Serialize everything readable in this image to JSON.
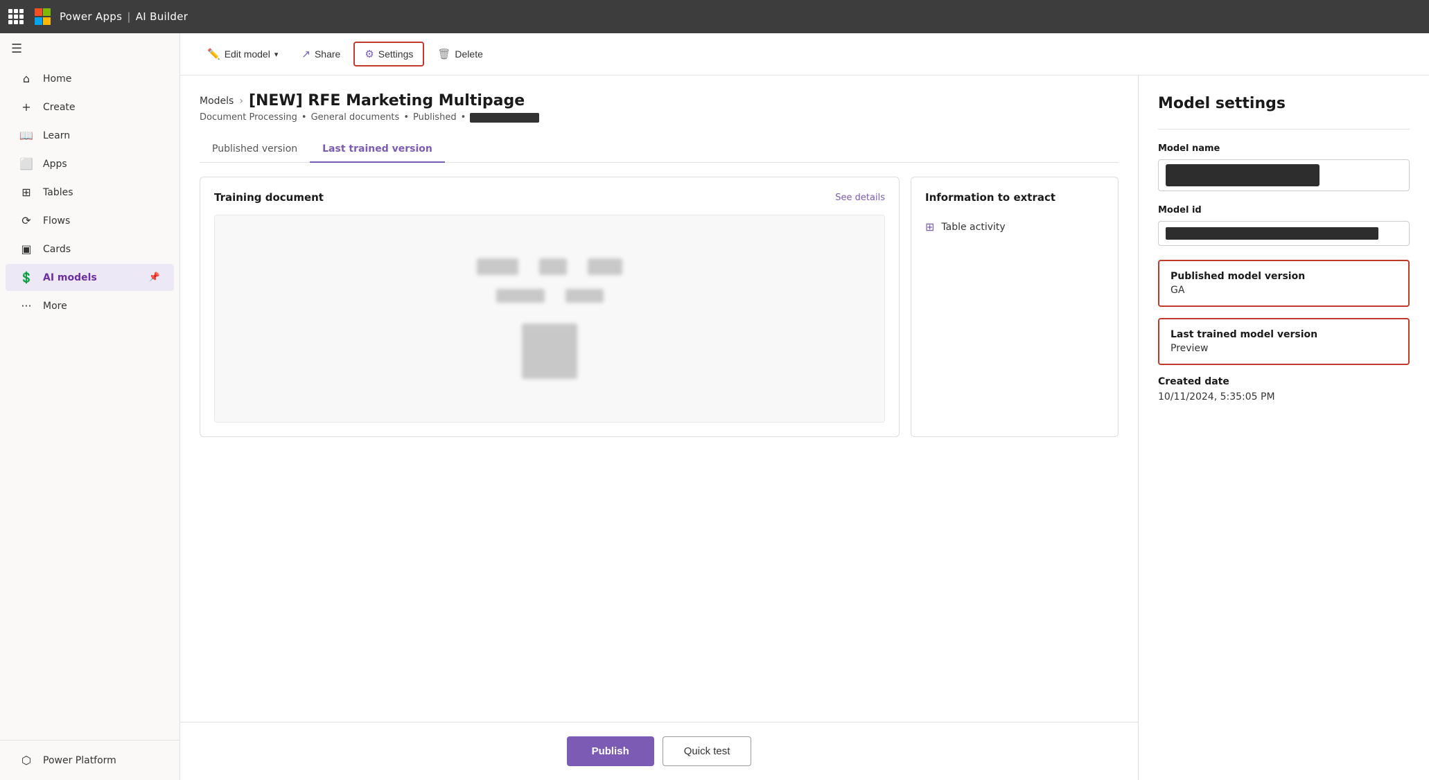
{
  "topbar": {
    "app_name": "Power Apps",
    "separator": "|",
    "section": "AI Builder"
  },
  "sidebar": {
    "items": [
      {
        "id": "home",
        "label": "Home",
        "icon": "⌂"
      },
      {
        "id": "create",
        "label": "Create",
        "icon": "+"
      },
      {
        "id": "learn",
        "label": "Learn",
        "icon": "📖"
      },
      {
        "id": "apps",
        "label": "Apps",
        "icon": "⬜"
      },
      {
        "id": "tables",
        "label": "Tables",
        "icon": "⊞"
      },
      {
        "id": "flows",
        "label": "Flows",
        "icon": "⟳"
      },
      {
        "id": "cards",
        "label": "Cards",
        "icon": "▣"
      },
      {
        "id": "ai_models",
        "label": "AI models",
        "icon": "💲",
        "active": true
      },
      {
        "id": "more",
        "label": "More",
        "icon": "···"
      }
    ],
    "bottom_item": {
      "label": "Power Platform",
      "icon": "⬡"
    }
  },
  "toolbar": {
    "edit_label": "Edit model",
    "share_label": "Share",
    "settings_label": "Settings",
    "delete_label": "Delete"
  },
  "breadcrumb": {
    "parent": "Models",
    "current": "[NEW] RFE Marketing Multipage"
  },
  "subtitle": {
    "type": "Document Processing",
    "category": "General documents",
    "status": "Published"
  },
  "tabs": [
    {
      "id": "published",
      "label": "Published version",
      "active": false
    },
    {
      "id": "last_trained",
      "label": "Last trained version",
      "active": true
    }
  ],
  "training_panel": {
    "title": "Training document",
    "see_details": "See details"
  },
  "info_panel": {
    "title": "Information to extract",
    "items": [
      {
        "label": "Table activity",
        "icon": "table"
      }
    ]
  },
  "actions": {
    "publish": "Publish",
    "quick_test": "Quick test"
  },
  "model_settings": {
    "title": "Model settings",
    "model_name_label": "Model name",
    "model_id_label": "Model id",
    "published_version_label": "Published model version",
    "published_version_value": "GA",
    "last_trained_version_label": "Last trained model version",
    "last_trained_version_value": "Preview",
    "created_date_label": "Created date",
    "created_date_value": "10/11/2024, 5:35:05 PM"
  }
}
